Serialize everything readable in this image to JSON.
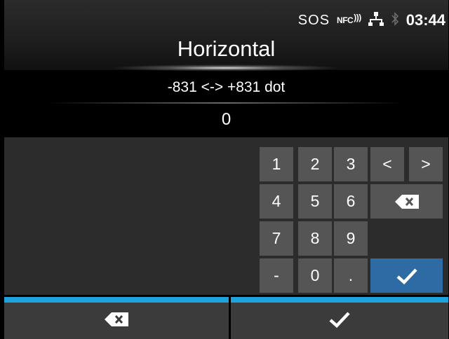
{
  "status": {
    "sos": "SOS",
    "nfc": "NFC",
    "time": "03:44"
  },
  "header": {
    "title": "Horizontal"
  },
  "input": {
    "range_text": "-831 <-> +831 dot",
    "value": "0"
  },
  "keypad": {
    "digits": [
      "1",
      "2",
      "3",
      "4",
      "5",
      "6",
      "7",
      "8",
      "9"
    ],
    "minus": "-",
    "zero": "0",
    "dot": ".",
    "left": "<",
    "right": ">"
  },
  "colors": {
    "accent": "#1fa3dc",
    "confirm": "#2e6aa3",
    "key": "#555555",
    "bottom_button": "#3b3b3b"
  },
  "icons": [
    "backspace-icon",
    "checkmark-icon",
    "network-icon",
    "bluetooth-icon",
    "nfc-icon"
  ]
}
